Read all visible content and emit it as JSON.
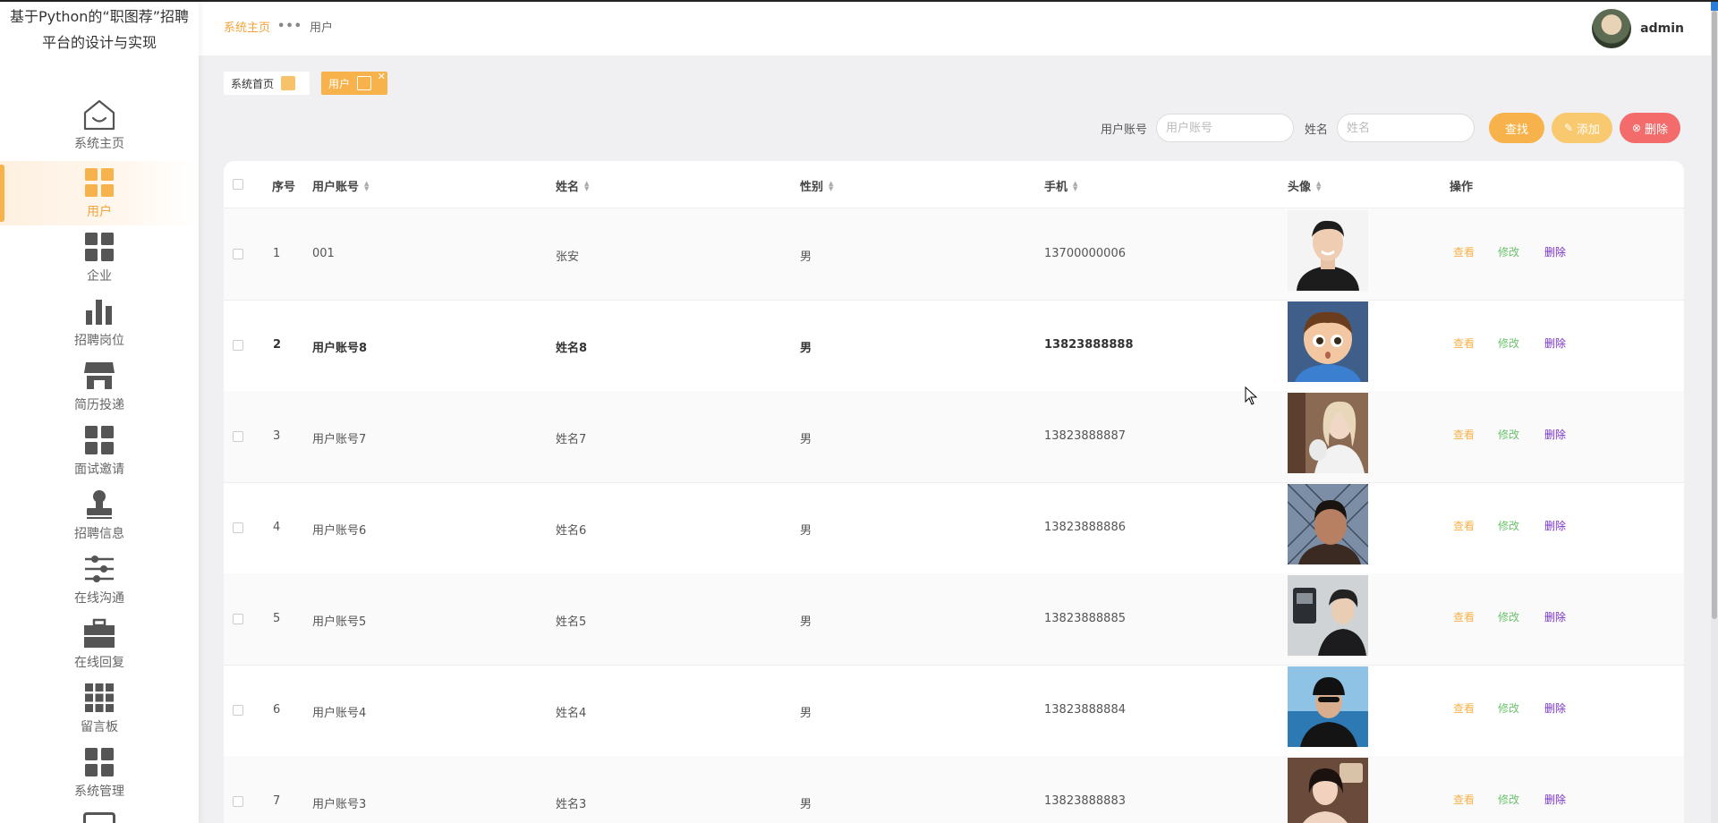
{
  "app": {
    "title": "基于Python的“职图荐”招聘平台的设计与实现"
  },
  "sidebar": {
    "items": [
      {
        "label": "系统主页",
        "icon": "home-icon"
      },
      {
        "label": "用户",
        "icon": "grid-icon"
      },
      {
        "label": "企业",
        "icon": "grid-icon"
      },
      {
        "label": "招聘岗位",
        "icon": "bar-chart-icon"
      },
      {
        "label": "简历投递",
        "icon": "shop-icon"
      },
      {
        "label": "面试邀请",
        "icon": "grid-icon"
      },
      {
        "label": "招聘信息",
        "icon": "stamp-icon"
      },
      {
        "label": "在线沟通",
        "icon": "sliders-icon"
      },
      {
        "label": "在线回复",
        "icon": "briefcase-icon"
      },
      {
        "label": "留言板",
        "icon": "grid9-icon"
      },
      {
        "label": "系统管理",
        "icon": "grid-icon"
      }
    ],
    "active_index": 1
  },
  "header": {
    "breadcrumb_home": "系统主页",
    "breadcrumb_current": "用户",
    "username": "admin"
  },
  "tags": {
    "home": "系统首页",
    "current": "用户"
  },
  "search": {
    "account_label": "用户账号",
    "account_placeholder": "用户账号",
    "account_value": "",
    "name_label": "姓名",
    "name_placeholder": "姓名",
    "name_value": "",
    "search_btn": "查找",
    "add_btn": "添加",
    "delete_btn": "删除"
  },
  "table": {
    "headers": {
      "index": "序号",
      "account": "用户账号",
      "name": "姓名",
      "gender": "性别",
      "phone": "手机",
      "avatar": "头像",
      "actions": "操作"
    },
    "action_labels": {
      "view": "查看",
      "edit": "修改",
      "delete": "删除"
    },
    "rows": [
      {
        "index": "1",
        "account": "001",
        "name": "张安",
        "gender": "男",
        "phone": "13700000006"
      },
      {
        "index": "2",
        "account": "用户账号8",
        "name": "姓名8",
        "gender": "男",
        "phone": "13823888888"
      },
      {
        "index": "3",
        "account": "用户账号7",
        "name": "姓名7",
        "gender": "男",
        "phone": "13823888887"
      },
      {
        "index": "4",
        "account": "用户账号6",
        "name": "姓名6",
        "gender": "男",
        "phone": "13823888886"
      },
      {
        "index": "5",
        "account": "用户账号5",
        "name": "姓名5",
        "gender": "男",
        "phone": "13823888885"
      },
      {
        "index": "6",
        "account": "用户账号4",
        "name": "姓名4",
        "gender": "男",
        "phone": "13823888884"
      },
      {
        "index": "7",
        "account": "用户账号3",
        "name": "姓名3",
        "gender": "男",
        "phone": "13823888883"
      }
    ]
  },
  "colors": {
    "accent": "#f7b24b",
    "edit": "#6cc36c",
    "delete_link": "#7a34c8",
    "delete_button": "#f46b6b"
  }
}
